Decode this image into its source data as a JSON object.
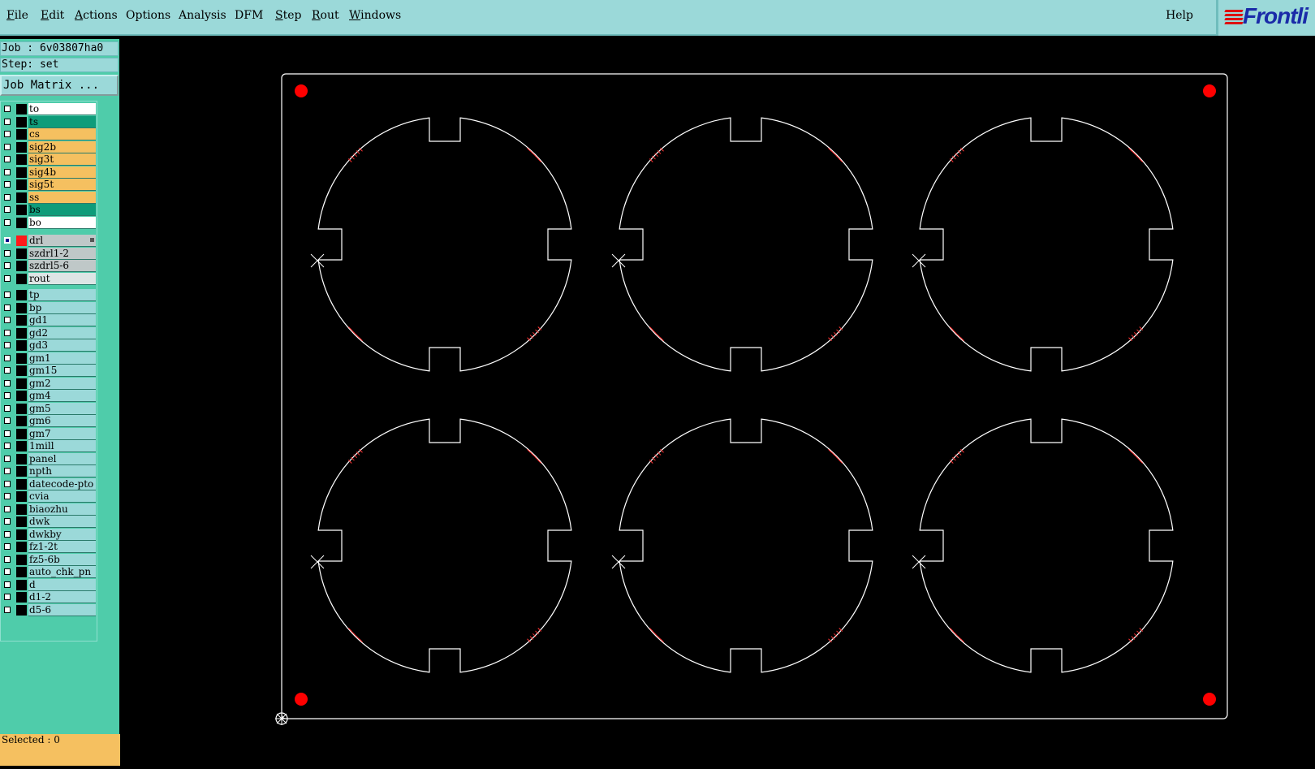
{
  "menu": {
    "file": "File",
    "edit": "Edit",
    "actions": "Actions",
    "options": "Options",
    "analysis": "Analysis",
    "dfm": "DFM",
    "step": "Step",
    "rout": "Rout",
    "windows": "Windows",
    "help": "Help"
  },
  "logo": {
    "text": "Frontli",
    "stripe_color": "#dd1111",
    "text_color": "#1a2ba8"
  },
  "job": {
    "label": "Job : 6v03807ha0"
  },
  "step": {
    "label": "Step: set"
  },
  "job_matrix": {
    "label": "Job Matrix ..."
  },
  "layers": {
    "board": [
      {
        "name": "to",
        "color": "#ffffff"
      },
      {
        "name": "ts",
        "color": "#0e9c7a"
      },
      {
        "name": "cs",
        "color": "#f5c060"
      },
      {
        "name": "sig2b",
        "color": "#f5c060"
      },
      {
        "name": "sig3t",
        "color": "#f5c060"
      },
      {
        "name": "sig4b",
        "color": "#f5c060"
      },
      {
        "name": "sig5t",
        "color": "#f5c060"
      },
      {
        "name": "ss",
        "color": "#f5c060"
      },
      {
        "name": "bs",
        "color": "#0e9c7a"
      },
      {
        "name": "bo",
        "color": "#ffffff"
      }
    ],
    "drill": [
      {
        "name": "drl",
        "color": "#bfc8c8",
        "active": true,
        "swatch": "red"
      },
      {
        "name": "szdrl1-2",
        "color": "#bfc8c8"
      },
      {
        "name": "szdrl5-6",
        "color": "#bfc8c8"
      },
      {
        "name": "rout",
        "color": "#dde5e5"
      }
    ],
    "misc": [
      {
        "name": "tp"
      },
      {
        "name": "bp"
      },
      {
        "name": "gd1"
      },
      {
        "name": "gd2"
      },
      {
        "name": "gd3"
      },
      {
        "name": "gm1"
      },
      {
        "name": "gm15"
      },
      {
        "name": "gm2"
      },
      {
        "name": "gm4"
      },
      {
        "name": "gm5"
      },
      {
        "name": "gm6"
      },
      {
        "name": "gm7"
      },
      {
        "name": "1mill"
      },
      {
        "name": "panel"
      },
      {
        "name": "npth"
      },
      {
        "name": "datecode-pto"
      },
      {
        "name": "cvia"
      },
      {
        "name": "biaozhu"
      },
      {
        "name": "dwk"
      },
      {
        "name": "dwkby"
      },
      {
        "name": "fz1-2t"
      },
      {
        "name": "fz5-6b"
      },
      {
        "name": "auto_chk_pn"
      },
      {
        "name": "d"
      },
      {
        "name": "d1-2"
      },
      {
        "name": "d5-6"
      }
    ],
    "misc_color": "#9bd9d9"
  },
  "status": {
    "selected": "Selected : 0"
  },
  "colors": {
    "outline": "#ffffff",
    "fiducial": "#ff0000",
    "tick": "#ff3333"
  }
}
